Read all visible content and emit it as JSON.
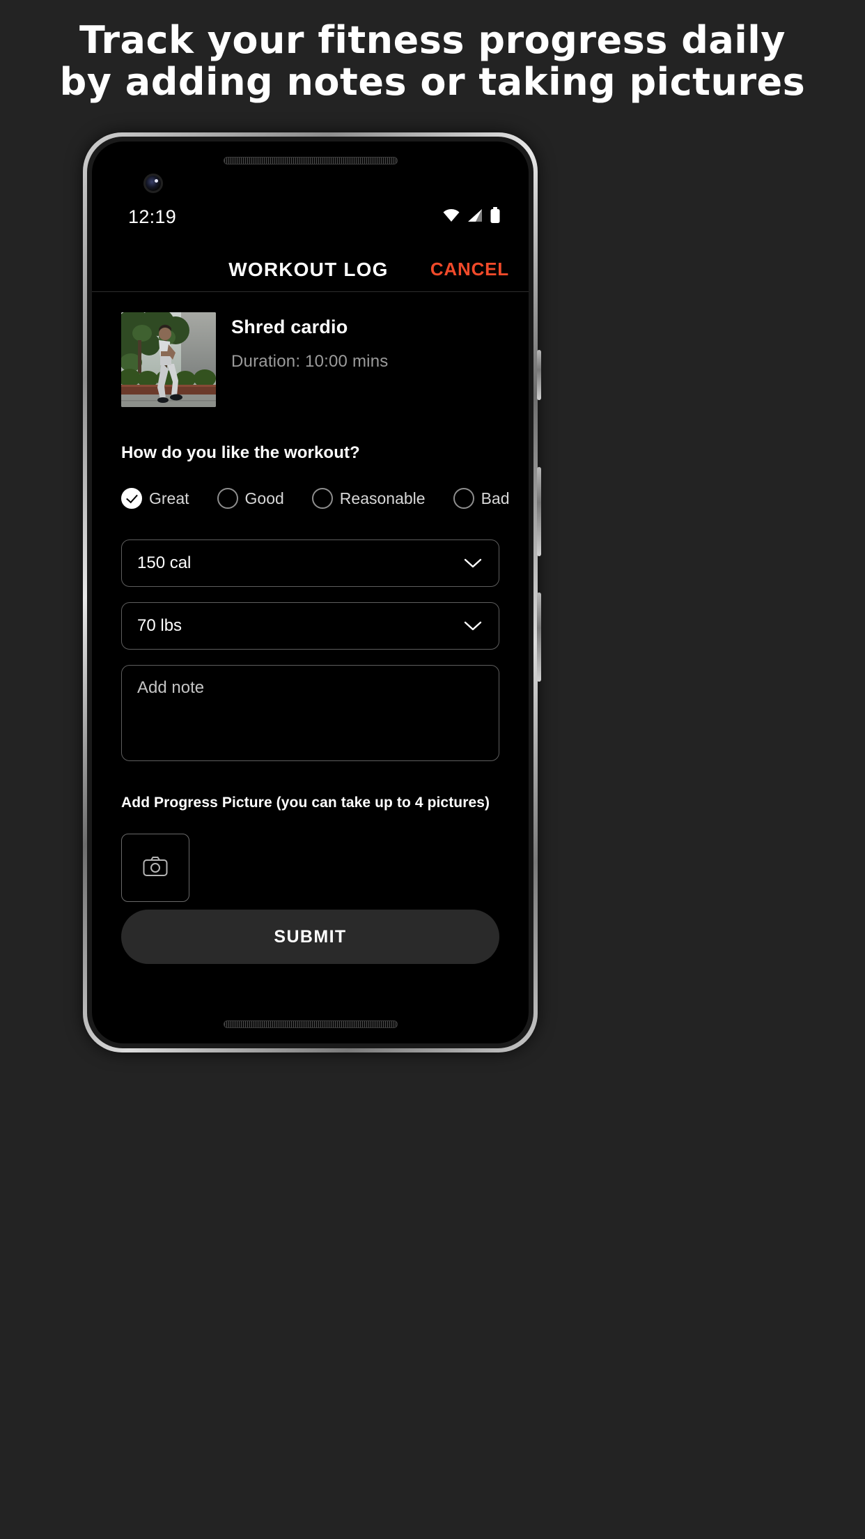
{
  "promo": {
    "line1": "Track your fitness progress daily",
    "line2": "by adding notes or taking pictures"
  },
  "status_bar": {
    "time": "12:19",
    "icons": [
      "wifi-icon",
      "cellular-signal-icon",
      "battery-icon"
    ]
  },
  "app_header": {
    "title": "WORKOUT LOG",
    "cancel_label": "CANCEL",
    "cancel_color": "#f04a2a"
  },
  "workout": {
    "name": "Shred cardio",
    "duration": "Duration: 10:00 mins",
    "thumbnail_alt": "woman-exercising-outdoors"
  },
  "rating": {
    "question": "How do you like the workout?",
    "options": [
      {
        "label": "Great",
        "selected": true
      },
      {
        "label": "Good",
        "selected": false
      },
      {
        "label": "Reasonable",
        "selected": false
      },
      {
        "label": "Bad",
        "selected": false
      }
    ]
  },
  "fields": {
    "calories": {
      "value": "150 cal",
      "icon": "chevron-down-icon"
    },
    "weight": {
      "value": "70 lbs",
      "icon": "chevron-down-icon"
    },
    "note": {
      "placeholder": "Add note",
      "value": ""
    }
  },
  "progress_picture": {
    "label": "Add Progress Picture (you can take up to 4 pictures)",
    "button_icon": "camera-icon",
    "max_pictures": 4
  },
  "submit": {
    "label": "SUBMIT"
  }
}
